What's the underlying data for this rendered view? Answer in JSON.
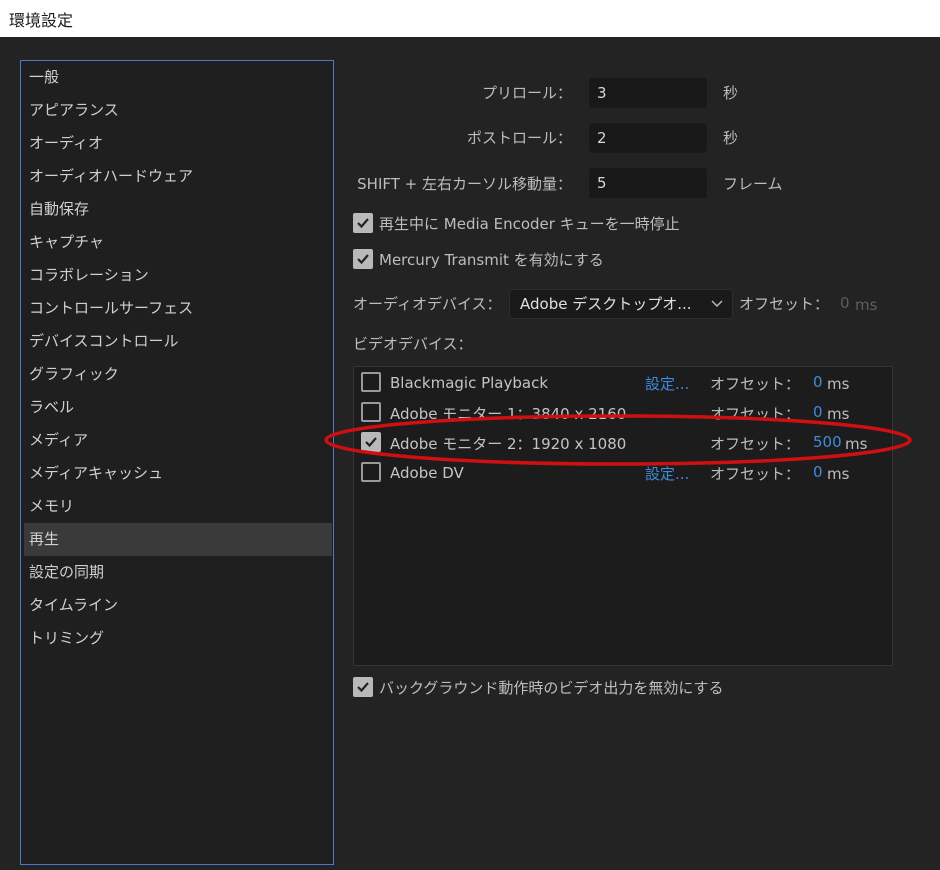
{
  "window": {
    "title": "環境設定"
  },
  "sidebar": {
    "items": [
      {
        "label": "一般"
      },
      {
        "label": "アピアランス"
      },
      {
        "label": "オーディオ"
      },
      {
        "label": "オーディオハードウェア"
      },
      {
        "label": "自動保存"
      },
      {
        "label": "キャプチャ"
      },
      {
        "label": "コラボレーション"
      },
      {
        "label": "コントロールサーフェス"
      },
      {
        "label": "デバイスコントロール"
      },
      {
        "label": "グラフィック"
      },
      {
        "label": "ラベル"
      },
      {
        "label": "メディア"
      },
      {
        "label": "メディアキャッシュ"
      },
      {
        "label": "メモリ"
      },
      {
        "label": "再生"
      },
      {
        "label": "設定の同期"
      },
      {
        "label": "タイムライン"
      },
      {
        "label": "トリミング"
      }
    ],
    "selected": "再生"
  },
  "playback": {
    "preroll": {
      "label": "プリロール：",
      "value": "3",
      "unit": "秒"
    },
    "postroll": {
      "label": "ポストロール：",
      "value": "2",
      "unit": "秒"
    },
    "shift_move": {
      "label": "SHIFT + 左右カーソル移動量：",
      "value": "5",
      "unit": "フレーム"
    },
    "pause_media_encoder": {
      "label": "再生中に Media Encoder キューを一時停止",
      "checked": true
    },
    "mercury_transmit": {
      "label": "Mercury Transmit を有効にする",
      "checked": true
    },
    "audio_device": {
      "label": "オーディオデバイス：",
      "value": "Adobe デスクトップオ...",
      "offset_label": "オフセット：",
      "offset_value": "0",
      "offset_unit": "ms"
    },
    "video_device": {
      "label": "ビデオデバイス："
    },
    "devices": [
      {
        "name": "Blackmagic Playback",
        "checked": false,
        "settings": "設定...",
        "offset_label": "オフセット：",
        "offset": "0",
        "unit": "ms"
      },
      {
        "name": "Adobe モニター 1：3840 x 2160",
        "checked": false,
        "settings": "",
        "offset_label": "オフセット：",
        "offset": "0",
        "unit": "ms"
      },
      {
        "name": "Adobe モニター 2：1920 x 1080",
        "checked": true,
        "settings": "",
        "offset_label": "オフセット：",
        "offset": "500",
        "unit": "ms"
      },
      {
        "name": "Adobe DV",
        "checked": false,
        "settings": "設定...",
        "offset_label": "オフセット：",
        "offset": "0",
        "unit": "ms"
      }
    ],
    "disable_background_video": {
      "label": "バックグラウンド動作時のビデオ出力を無効にする",
      "checked": true
    }
  },
  "colors": {
    "accent": "#3e8cdc",
    "highlight_annotation": "#d01010",
    "selection_border": "#4b79c9"
  }
}
